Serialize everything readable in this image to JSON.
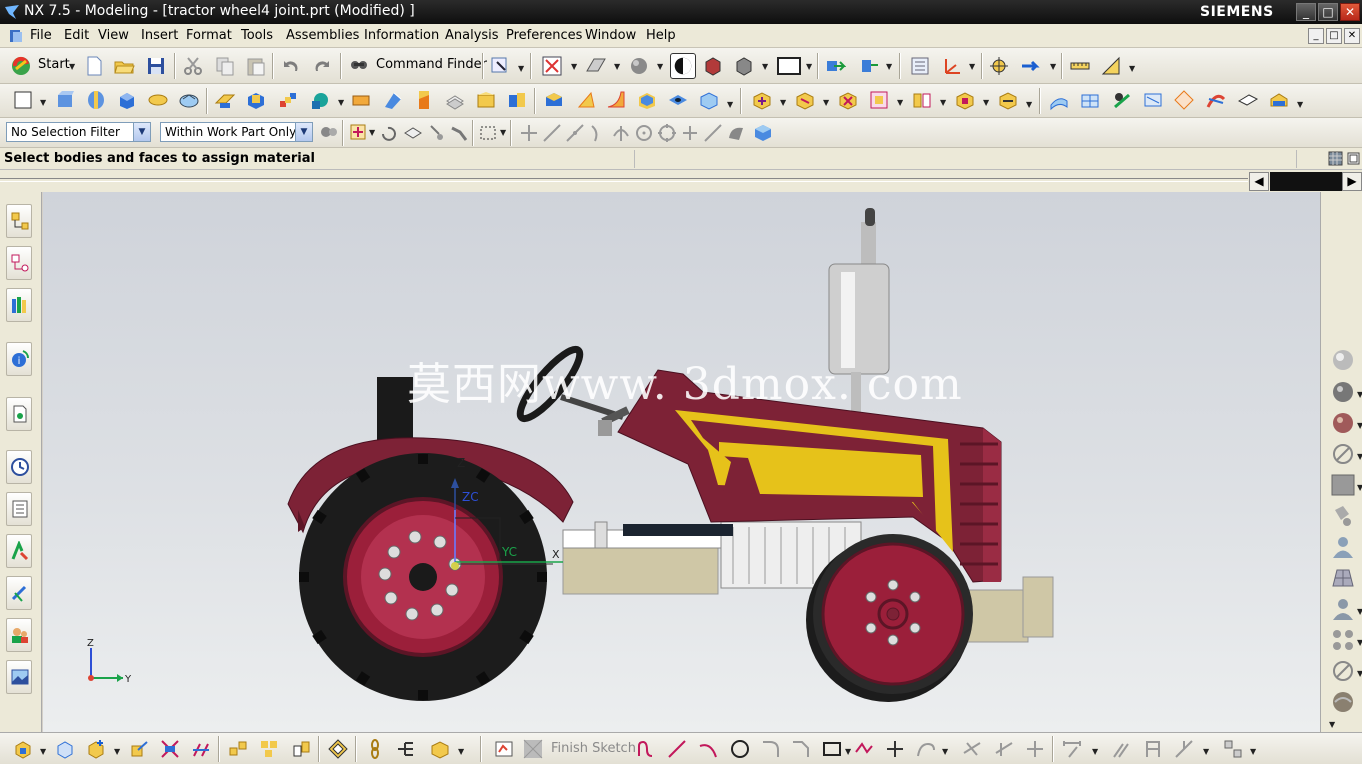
{
  "window": {
    "title": "NX 7.5 - Modeling - [tractor wheel4 joint.prt (Modified) ]",
    "brand": "SIEMENS",
    "controls": {
      "minimize": "_",
      "maximize": "□",
      "close": "✕"
    }
  },
  "menubar": {
    "items": [
      "File",
      "Edit",
      "View",
      "Insert",
      "Format",
      "Tools",
      "Assemblies",
      "Information",
      "Analysis",
      "Preferences",
      "Window",
      "Help"
    ]
  },
  "toolbar": {
    "start_label": "Start",
    "command_finder_label": "Command Finder"
  },
  "selection": {
    "filter_value": "No Selection Filter",
    "scope_value": "Within Work Part Only"
  },
  "status": {
    "cue_text": "Select bodies and faces to assign material"
  },
  "viewport": {
    "watermark": "莫西网www. 3dmox. com",
    "csys_labels": {
      "z": "Z",
      "zc": "ZC",
      "yc": "YC",
      "x": "X"
    },
    "triad_labels": {
      "z": "Z",
      "y": "Y"
    },
    "colors": {
      "body": "#7d2236",
      "stripe": "#e6c21a",
      "tire": "#1c1c1c",
      "rim": "#9b1f3a",
      "exhaust": "#c9c9c9",
      "frame": "#cfc7a6",
      "background_top": "#cfd3da",
      "background_bottom": "#eceeef"
    }
  },
  "bottom_toolbar": {
    "finish_sketch_label": "Finish Sketch"
  }
}
